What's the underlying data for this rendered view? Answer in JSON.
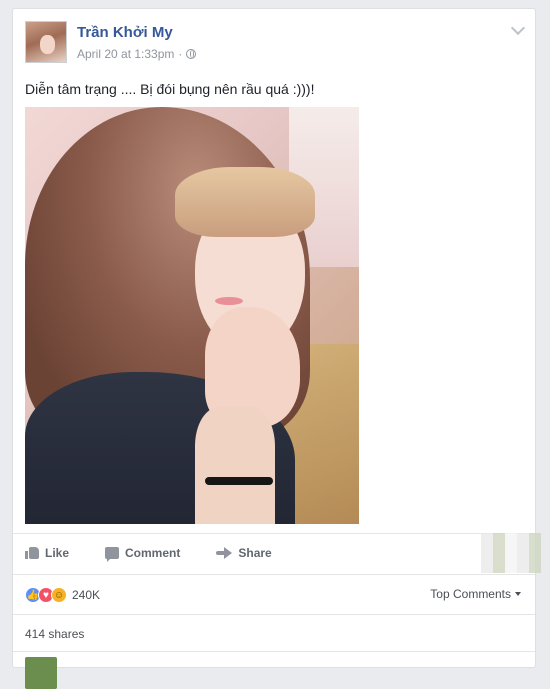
{
  "post": {
    "author": "Trần Khởi My",
    "date": "April 20 at 1:33pm",
    "separator": "·",
    "status": "Diễn tâm trạng .... Bị đói bụng nên rầu quá :)))!",
    "photo_icon": "profile-photo"
  },
  "actions": {
    "like": "Like",
    "comment": "Comment",
    "share": "Share"
  },
  "reactions": {
    "count": "240K",
    "icons": [
      "like-icon",
      "love-icon",
      "haha-icon"
    ],
    "sort_label": "Top Comments"
  },
  "shares": {
    "label": "414 shares"
  },
  "colors": {
    "author_link": "#365899",
    "like_reaction": "#5890ff",
    "love_reaction": "#f25268",
    "haha_reaction": "#f7b125",
    "feed_background": "#e9ebee"
  }
}
